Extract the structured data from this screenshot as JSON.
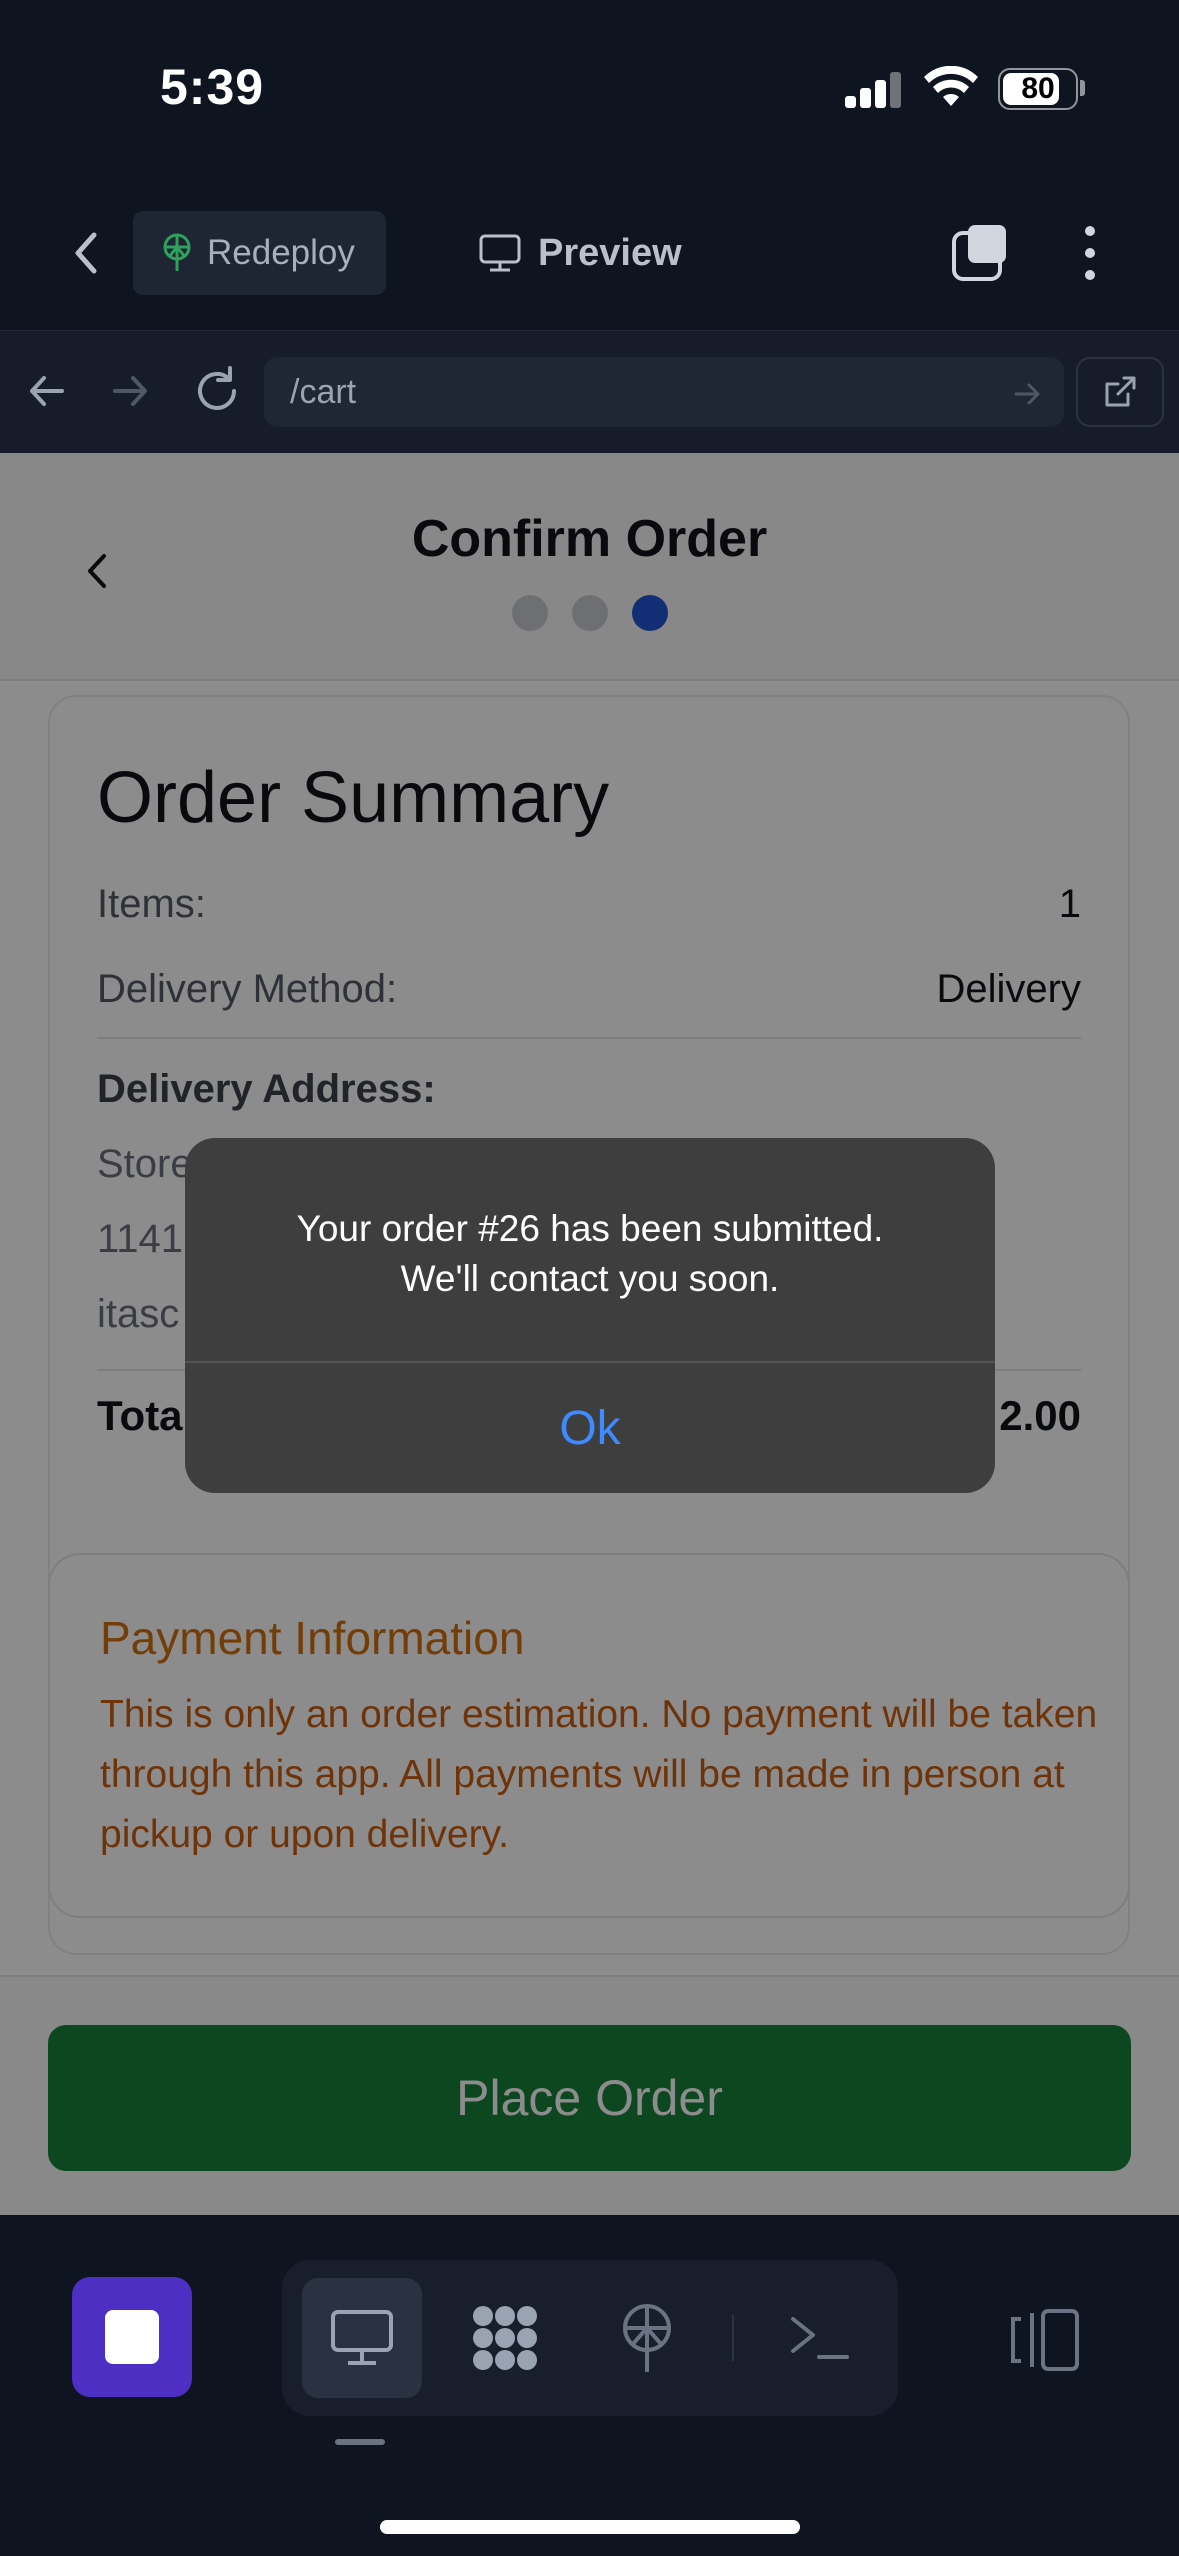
{
  "status_bar": {
    "time": "5:39",
    "battery": "80",
    "battery_level": 0.8
  },
  "toolbar": {
    "redeploy_label": "Redeploy",
    "preview_label": "Preview"
  },
  "urlbar": {
    "url": "/cart"
  },
  "page": {
    "title": "Confirm Order",
    "steps": 3,
    "active_step": 3,
    "summary": {
      "title": "Order Summary",
      "items_label": "Items:",
      "items_value": "1",
      "delivery_method_label": "Delivery Method:",
      "delivery_method_value": "Delivery",
      "address_label": "Delivery Address:",
      "address_lines": [
        "Store",
        "1141",
        "itasc"
      ],
      "total_label": "Tota",
      "total_value": "2.00"
    },
    "payment": {
      "title": "Payment Information",
      "text": "This is only an order estimation. No payment will be taken through this app. All payments will be made in person at pickup or upon delivery."
    },
    "place_order_label": "Place Order"
  },
  "alert": {
    "message_line1": "Your order #26 has been submitted.",
    "message_line2": "We'll contact you soon.",
    "ok_label": "Ok"
  },
  "dock": {
    "items": [
      "desktop-icon",
      "apps-grid-icon",
      "deploy-icon",
      "terminal-icon"
    ],
    "active_item": "desktop-icon"
  },
  "colors": {
    "accent_blue": "#2157d6",
    "primary_green": "#16813a",
    "payment_orange": "#d2700f",
    "stop_purple": "#4d2fc4",
    "alert_link": "#3d8bff"
  }
}
